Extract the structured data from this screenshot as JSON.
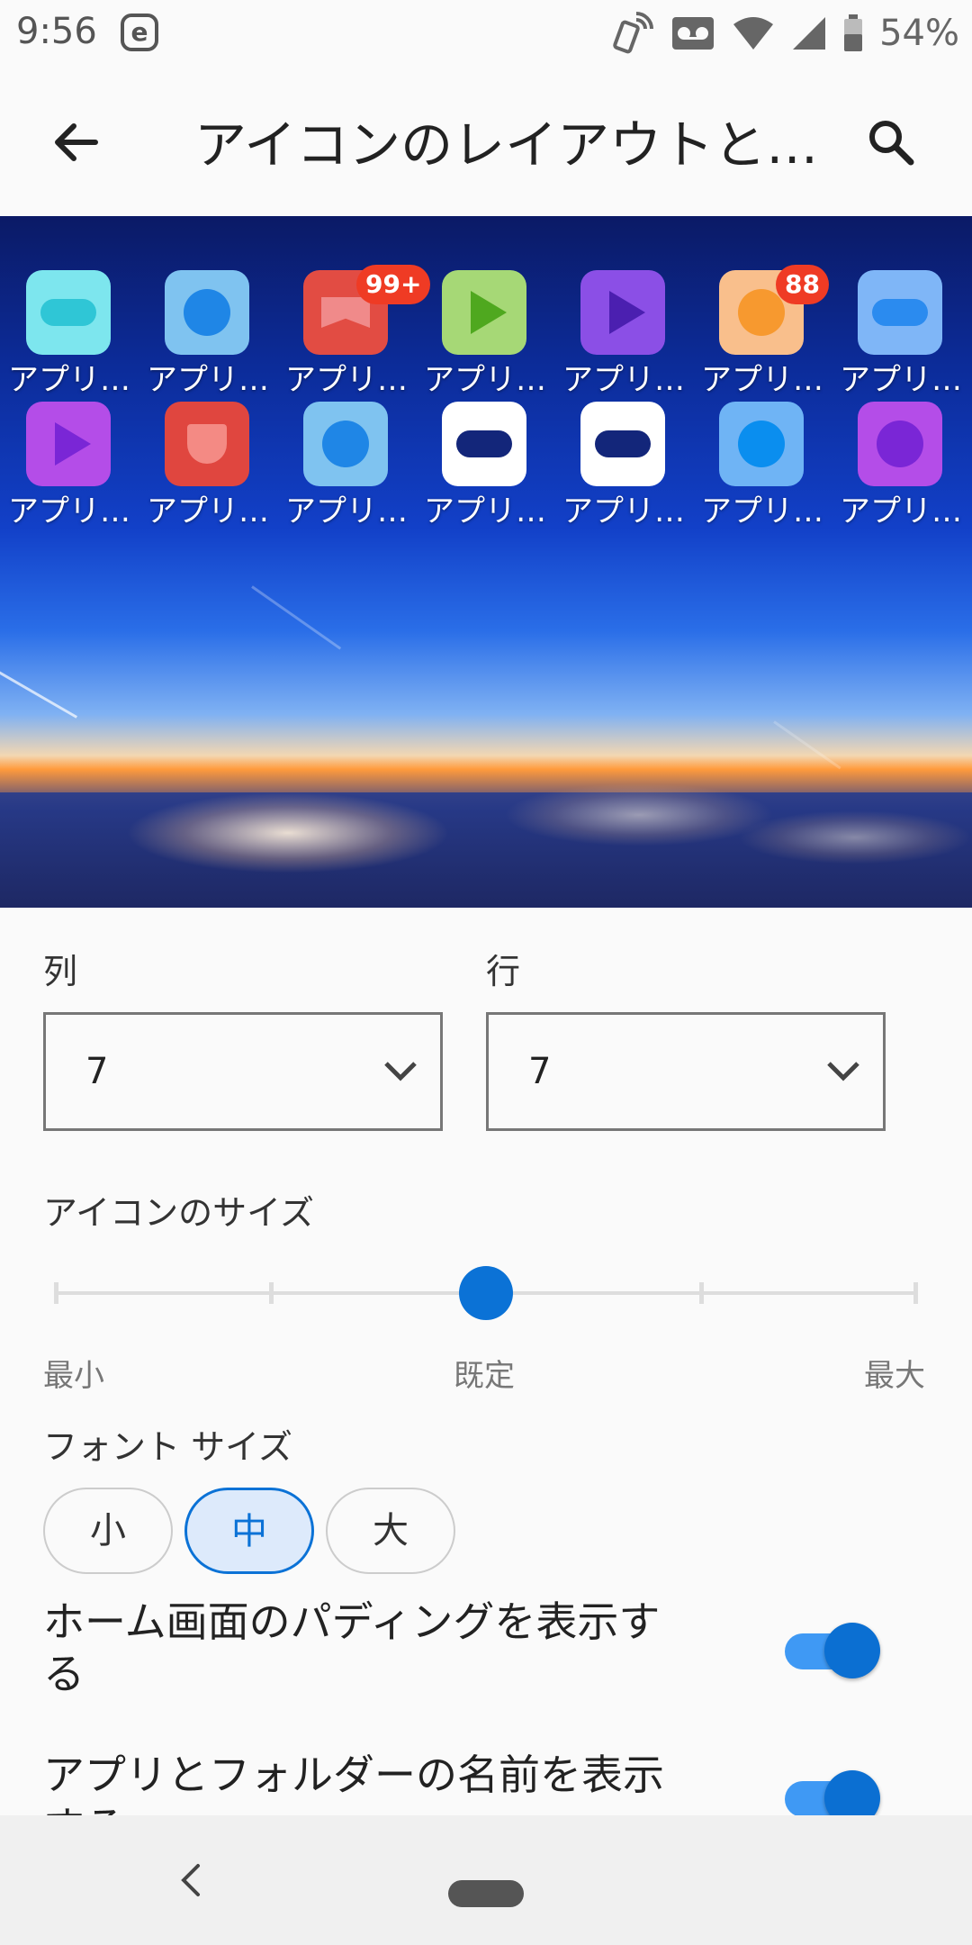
{
  "status": {
    "time": "9:56",
    "e_badge": "e",
    "battery": "54%"
  },
  "app_bar": {
    "title": "アイコンのレイアウトと…"
  },
  "preview": {
    "apps": [
      {
        "label": "アプリ…",
        "color": "#7de6ee",
        "glyph": "pill",
        "glyph_color": "#2fc6d6",
        "badge": ""
      },
      {
        "label": "アプリ…",
        "color": "#7fc3f0",
        "glyph": "dot",
        "glyph_color": "#1f86e6",
        "badge": ""
      },
      {
        "label": "アプリ…",
        "color": "#e24c43",
        "glyph": "ribbon",
        "glyph_color": "#f08a8a",
        "badge": "99+"
      },
      {
        "label": "アプリ…",
        "color": "#a6d876",
        "glyph": "play",
        "glyph_color": "#4fa81f",
        "badge": ""
      },
      {
        "label": "アプリ…",
        "color": "#8b4fe6",
        "glyph": "play",
        "glyph_color": "#4b1fb0",
        "badge": ""
      },
      {
        "label": "アプリ…",
        "color": "#f9bf8c",
        "glyph": "dot",
        "glyph_color": "#f7992f",
        "badge": "88"
      },
      {
        "label": "アプリ…",
        "color": "#7fb6f7",
        "glyph": "pill",
        "glyph_color": "#2b8bef",
        "badge": ""
      },
      {
        "label": "アプリ…",
        "color": "#b44de8",
        "glyph": "play",
        "glyph_color": "#7a26d6",
        "badge": ""
      },
      {
        "label": "アプリ…",
        "color": "#e0463f",
        "glyph": "cup",
        "glyph_color": "#f48a84",
        "badge": ""
      },
      {
        "label": "アプリ…",
        "color": "#7fc3f0",
        "glyph": "dot",
        "glyph_color": "#1f86e6",
        "badge": ""
      },
      {
        "label": "アプリ…",
        "color": "#ffffff",
        "glyph": "pill",
        "glyph_color": "#13267a",
        "badge": ""
      },
      {
        "label": "アプリ…",
        "color": "#ffffff",
        "glyph": "pill",
        "glyph_color": "#13267a",
        "badge": ""
      },
      {
        "label": "アプリ…",
        "color": "#6fb4f5",
        "glyph": "dot",
        "glyph_color": "#0a8eef",
        "badge": ""
      },
      {
        "label": "アプリ…",
        "color": "#b44de8",
        "glyph": "dot",
        "glyph_color": "#7a26d6",
        "badge": ""
      }
    ]
  },
  "layout": {
    "columns_label": "列",
    "columns_value": "7",
    "rows_label": "行",
    "rows_value": "7"
  },
  "icon_size": {
    "label": "アイコンのサイズ",
    "min_label": "最小",
    "default_label": "既定",
    "max_label": "最大",
    "level": 0.5
  },
  "font_size": {
    "label": "フォント サイズ",
    "options": [
      "小",
      "中",
      "大"
    ],
    "selected": "中"
  },
  "toggles": [
    {
      "label": "ホーム画面のパディングを表示する",
      "on": true
    },
    {
      "label": "アプリとフォルダーの名前を表示する",
      "on": true
    }
  ],
  "colors": {
    "accent": "#0b72d6",
    "toggle_track": "#3f99f4"
  }
}
